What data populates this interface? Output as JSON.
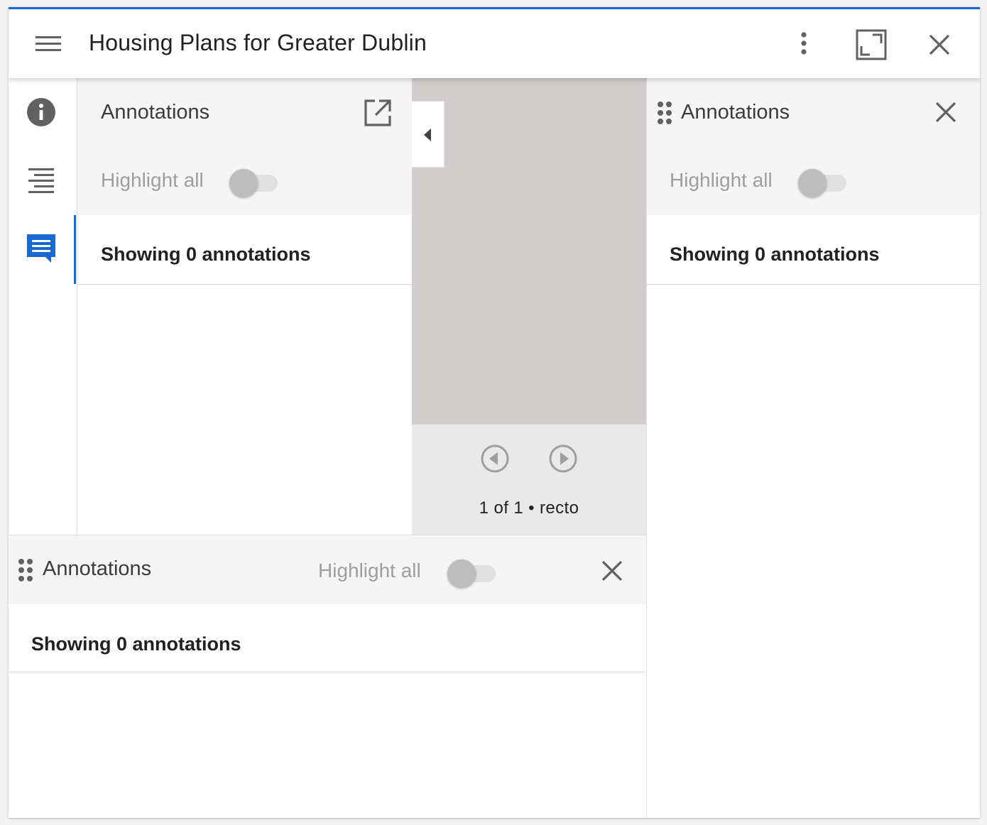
{
  "window": {
    "title": "Housing Plans for Greater Dublin",
    "accent": "#1967d2"
  },
  "rail": {
    "items": [
      {
        "icon": "info-icon"
      },
      {
        "icon": "toc-icon"
      },
      {
        "icon": "annotations-icon",
        "active": true
      }
    ]
  },
  "companion": {
    "title": "Annotations",
    "highlight_label": "Highlight all",
    "highlight_on": false,
    "showing": "Showing 0 annotations"
  },
  "canvas": {
    "page_info": "1 of 1 • recto"
  },
  "right_window": {
    "title": "Annotations",
    "highlight_label": "Highlight all",
    "highlight_on": false,
    "showing": "Showing 0 annotations"
  },
  "bottom_window": {
    "title": "Annotations",
    "highlight_label": "Highlight all",
    "highlight_on": false,
    "showing": "Showing 0 annotations"
  }
}
